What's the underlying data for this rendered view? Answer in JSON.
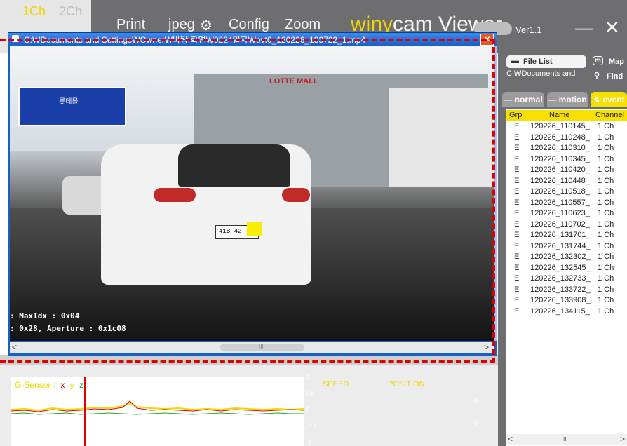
{
  "app": {
    "top_tabs": [
      "1Ch",
      "2Ch"
    ],
    "menu": [
      "Print",
      "jpeg",
      "Config",
      "Zoom"
    ],
    "brand_prefix": "winy",
    "brand_rest": "cam Viewer",
    "version": "Ver1.1",
    "minimize": "—",
    "close": "✕"
  },
  "video_window": {
    "title": "C:₩Documents and Settings₩Owner₩바탕 화면₩0224일자₩evt0_120226_133722_1.mp4",
    "close": "✕",
    "overlay_line1": ": MaxIdx : 0x04",
    "overlay_line2": ": 0x28, Aperture : 0x1c08",
    "sign_text": "롯데몰",
    "mall_text": "LOTTE MALL",
    "plate": "41B 42",
    "scroll_left": "<",
    "scroll_right": ">",
    "scroll_grip": "III"
  },
  "sensor": {
    "gsensor_label": "G-Sensor :",
    "x": "x",
    "y": "y",
    "z": "z",
    "axis": [
      "1",
      "0.5",
      "0",
      "-0.5",
      "-1"
    ],
    "speed_label": "SPEED",
    "position_label": "POSITION",
    "speed_value": "0",
    "position_value": "0"
  },
  "sidebar": {
    "file_list_button": "File List",
    "map_button": "Map",
    "path": "C:₩Documents and",
    "find_button": "Find",
    "tabs": [
      "normal",
      "motion",
      "event"
    ],
    "columns": [
      "Grp",
      "Name",
      "Channel"
    ],
    "rows": [
      {
        "grp": "E",
        "name": "120226_110145_",
        "channel": "1 Ch"
      },
      {
        "grp": "E",
        "name": "120226_110248_",
        "channel": "1 Ch"
      },
      {
        "grp": "E",
        "name": "120226_110310_",
        "channel": "1 Ch"
      },
      {
        "grp": "E",
        "name": "120226_110345_",
        "channel": "1 Ch"
      },
      {
        "grp": "E",
        "name": "120226_110420_",
        "channel": "1 Ch"
      },
      {
        "grp": "E",
        "name": "120226_110448_",
        "channel": "1 Ch"
      },
      {
        "grp": "E",
        "name": "120226_110518_",
        "channel": "1 Ch"
      },
      {
        "grp": "E",
        "name": "120226_110557_",
        "channel": "1 Ch"
      },
      {
        "grp": "E",
        "name": "120226_110623_",
        "channel": "1 Ch"
      },
      {
        "grp": "E",
        "name": "120226_110702_",
        "channel": "1 Ch"
      },
      {
        "grp": "E",
        "name": "120226_131701_",
        "channel": "1 Ch"
      },
      {
        "grp": "E",
        "name": "120226_131744_",
        "channel": "1 Ch"
      },
      {
        "grp": "E",
        "name": "120226_132302_",
        "channel": "1 Ch"
      },
      {
        "grp": "E",
        "name": "120226_132545_",
        "channel": "1 Ch"
      },
      {
        "grp": "E",
        "name": "120226_132733_",
        "channel": "1 Ch"
      },
      {
        "grp": "E",
        "name": "120226_133722_",
        "channel": "1 Ch"
      },
      {
        "grp": "E",
        "name": "120226_133908_",
        "channel": "1 Ch"
      },
      {
        "grp": "E",
        "name": "120226_134115_",
        "channel": "1 Ch"
      }
    ],
    "scroll_left": "<",
    "scroll_right": ">",
    "scroll_grip": "III"
  },
  "colors": {
    "accent_yellow": "#f7e000",
    "highlight_red": "#e00000",
    "window_blue": "#1660c8",
    "chrome_gray": "#6e6e70",
    "gsensor_x": "#e00000",
    "gsensor_y": "#f0d800",
    "gsensor_z": "#2aa02a"
  },
  "icons": {
    "file_list": "folder-icon",
    "map": "map-icon",
    "find": "search-icon",
    "config": "gear-icon",
    "title": "camera-icon"
  }
}
